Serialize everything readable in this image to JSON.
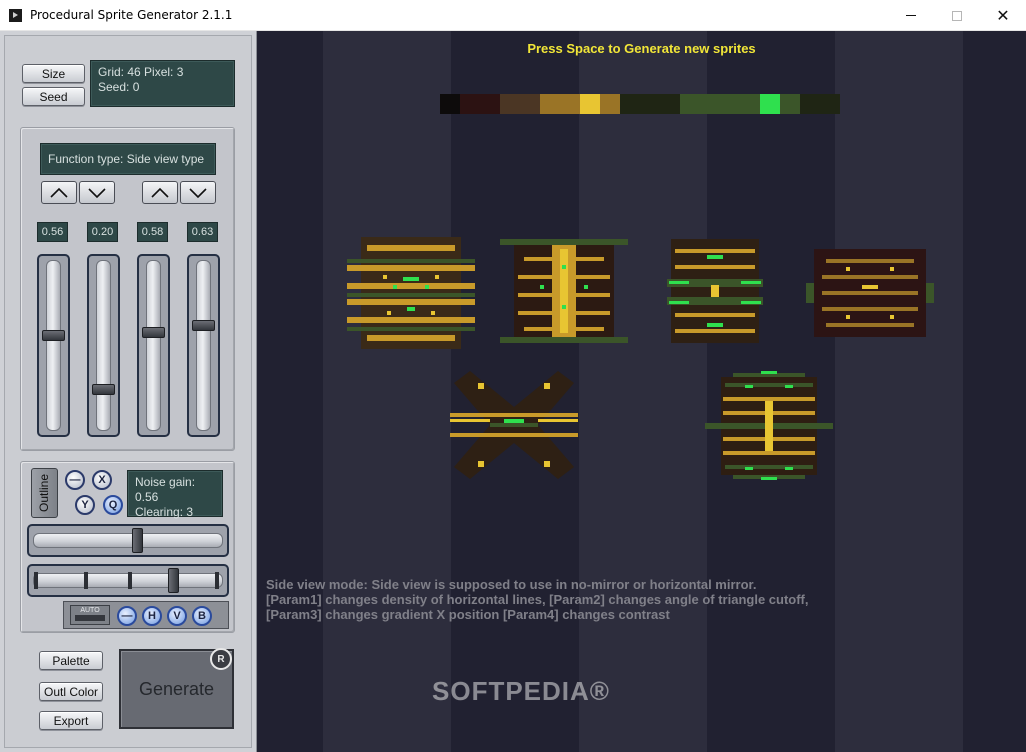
{
  "window": {
    "title": "Procedural Sprite Generator 2.1.1",
    "minimize": "",
    "maximize": "",
    "close": "✕"
  },
  "top": {
    "size_label": "Size",
    "seed_label": "Seed",
    "grid_info": "Grid: 46 Pixel: 3",
    "seed_info": "Seed: 0"
  },
  "function": {
    "type_label": "Function type: Side view type",
    "params": [
      {
        "value_label": "0.56",
        "value": 0.56
      },
      {
        "value_label": "0.20",
        "value": 0.2
      },
      {
        "value_label": "0.58",
        "value": 0.58
      },
      {
        "value_label": "0.63",
        "value": 0.63
      }
    ]
  },
  "noise": {
    "outline_label": "Outline",
    "minus_label": "—",
    "x_label": "X",
    "y_label": "Y",
    "q_label": "Q",
    "gain_text": "Noise gain: 0.56",
    "clearing_text": "Clearing: 3",
    "gain_value": 0.56,
    "clearing_value": 3,
    "auto_label": "AUTO",
    "flags": [
      "—",
      "H",
      "V",
      "B"
    ]
  },
  "bottom": {
    "palette_label": "Palette",
    "outl_color_label": "Outl Color",
    "export_label": "Export",
    "generate_label": "Generate",
    "reg_label": "R"
  },
  "canvas": {
    "hint": "Press Space to Generate new sprites",
    "palette_colors": [
      "#0d0b0b",
      "#2c1212",
      "#4b3624",
      "#9a7426",
      "#e8c532",
      "#9a7426",
      "#1f2514",
      "#3b5529",
      "#2fe04e",
      "#3b5529",
      "#1f2514"
    ],
    "help_lines": [
      "Side view mode: Side view is supposed to use in no-mirror or horizontal mirror.",
      "[Param1] changes density of horizontal lines, [Param2] changes angle of triangle cutoff,",
      "[Param3] changes gradient X position [Param4] changes contrast"
    ],
    "watermark": "SOFTPEDIA®"
  }
}
